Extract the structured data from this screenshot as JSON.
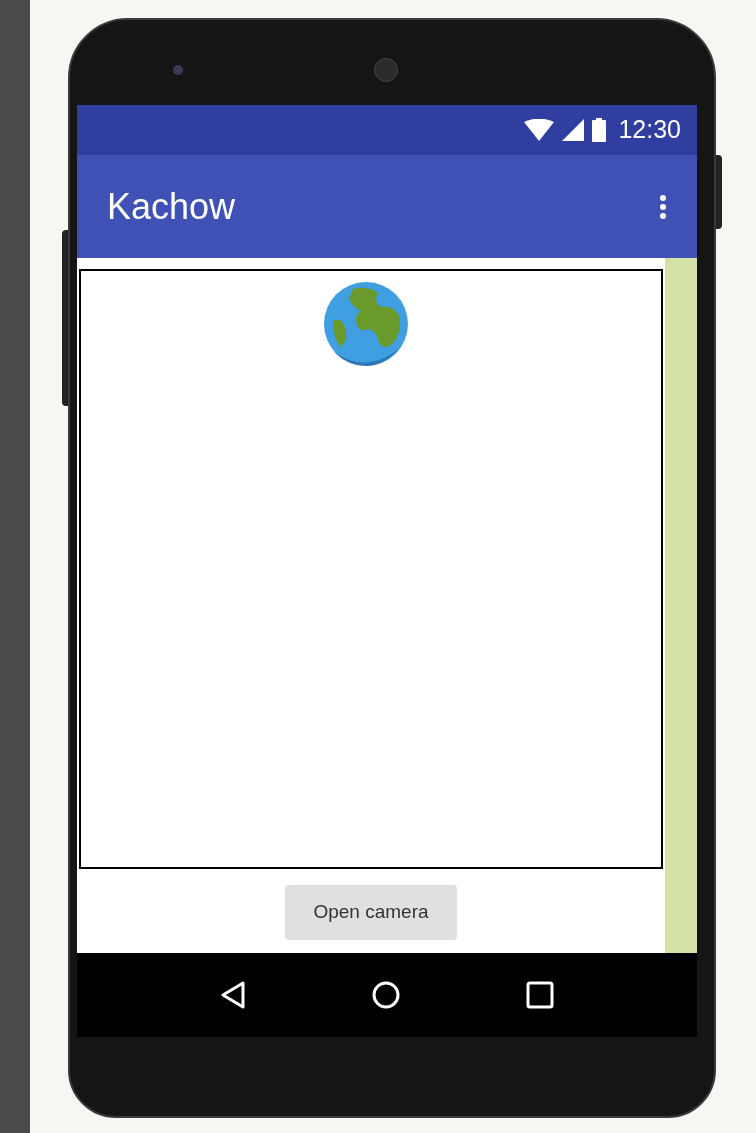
{
  "status_bar": {
    "time": "12:30"
  },
  "app_bar": {
    "title": "Kachow"
  },
  "content": {
    "button": {
      "label": "Open camera"
    }
  }
}
